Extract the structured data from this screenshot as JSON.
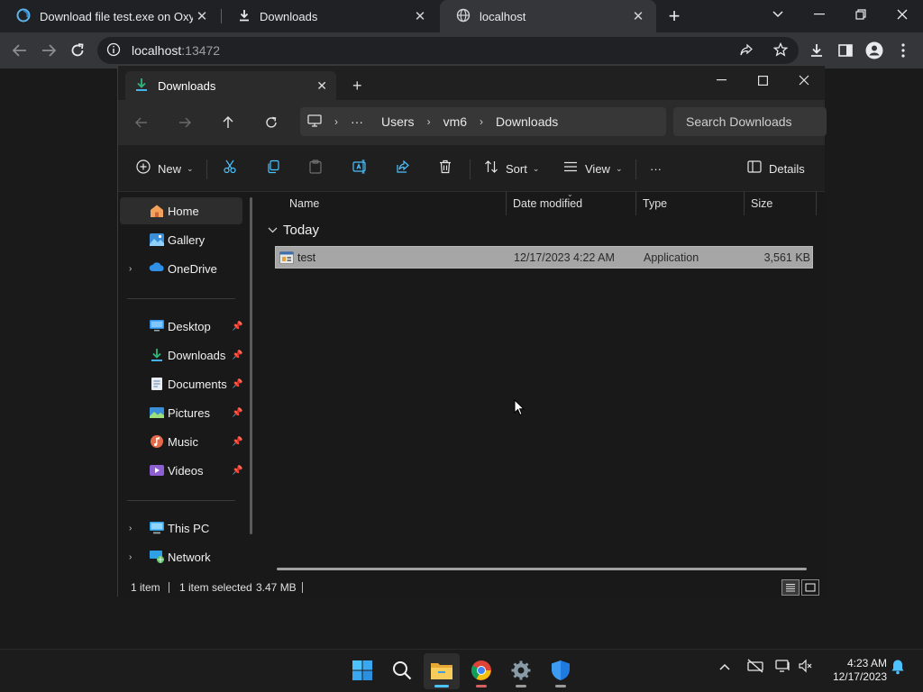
{
  "browser": {
    "tabs": [
      {
        "title": "Download file test.exe on Oxy.Cl",
        "close": "✕",
        "icon": "oxy-favicon-icon"
      },
      {
        "title": "Downloads",
        "close": "✕",
        "icon": "download-icon"
      },
      {
        "title": "localhost",
        "close": "✕",
        "icon": "globe-icon"
      }
    ],
    "new_tab": "+",
    "url_host": "localhost",
    "url_port": ":13472"
  },
  "explorer": {
    "tab_title": "Downloads",
    "new_tab": "+",
    "breadcrumb": [
      "Users",
      "vm6",
      "Downloads"
    ],
    "breadcrumb_more": "···",
    "search_placeholder": "Search Downloads",
    "commands": {
      "new": "New",
      "sort": "Sort",
      "view": "View",
      "more": "···",
      "details": "Details"
    },
    "sidebar": {
      "top": [
        {
          "label": "Home",
          "icon": "home-icon"
        },
        {
          "label": "Gallery",
          "icon": "gallery-icon"
        },
        {
          "label": "OneDrive",
          "icon": "onedrive-icon",
          "expander": "›"
        }
      ],
      "pinned": [
        {
          "label": "Desktop",
          "icon": "desktop-icon"
        },
        {
          "label": "Downloads",
          "icon": "downloads-icon"
        },
        {
          "label": "Documents",
          "icon": "documents-icon"
        },
        {
          "label": "Pictures",
          "icon": "pictures-icon"
        },
        {
          "label": "Music",
          "icon": "music-icon"
        },
        {
          "label": "Videos",
          "icon": "videos-icon"
        }
      ],
      "bottom": [
        {
          "label": "This PC",
          "icon": "this-pc-icon",
          "expander": "›"
        },
        {
          "label": "Network",
          "icon": "network-icon",
          "expander": "›"
        }
      ]
    },
    "columns": {
      "name": "Name",
      "date": "Date modified",
      "type": "Type",
      "size": "Size"
    },
    "group": "Today",
    "files": [
      {
        "name": "test",
        "date": "12/17/2023 4:22 AM",
        "type": "Application",
        "size": "3,561 KB"
      }
    ],
    "status": {
      "count": "1 item",
      "selected": "1 item selected",
      "size": "3.47 MB"
    }
  },
  "taskbar": {
    "clock_time": "4:23 AM",
    "clock_date": "12/17/2023"
  },
  "colors": {
    "accent": "#4cc2ff",
    "selection": "#a6a6a6",
    "chrome_toolbar": "#35363a"
  }
}
